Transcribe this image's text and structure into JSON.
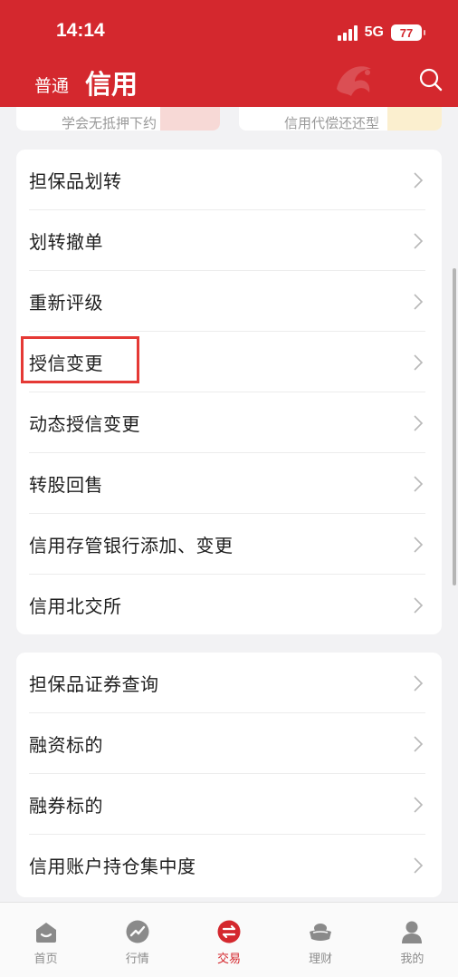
{
  "status_bar": {
    "time": "14:14",
    "network": "5G",
    "battery": "77"
  },
  "header": {
    "tab_normal": "普通",
    "tab_credit": "信用"
  },
  "top_cards": {
    "left_text": "学会无抵押下约",
    "right_text": "信用代偿还还型"
  },
  "menu_group_1": [
    {
      "label": "担保品划转"
    },
    {
      "label": "划转撤单"
    },
    {
      "label": "重新评级"
    },
    {
      "label": "授信变更"
    },
    {
      "label": "动态授信变更"
    },
    {
      "label": "转股回售"
    },
    {
      "label": "信用存管银行添加、变更"
    },
    {
      "label": "信用北交所"
    }
  ],
  "menu_group_2": [
    {
      "label": "担保品证券查询"
    },
    {
      "label": "融资标的"
    },
    {
      "label": "融券标的"
    },
    {
      "label": "信用账户持仓集中度"
    }
  ],
  "bottom_nav": [
    {
      "label": "首页",
      "icon": "home-icon"
    },
    {
      "label": "行情",
      "icon": "market-chart-icon"
    },
    {
      "label": "交易",
      "icon": "trade-exchange-icon"
    },
    {
      "label": "理财",
      "icon": "ingot-icon"
    },
    {
      "label": "我的",
      "icon": "user-icon"
    }
  ],
  "colors": {
    "brand_red": "#d4282e",
    "highlight": "#e53935",
    "nav_inactive": "#8c8c8c"
  }
}
